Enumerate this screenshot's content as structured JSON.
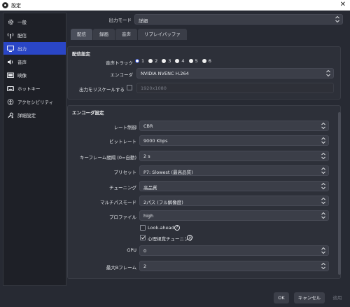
{
  "window": {
    "title": "設定"
  },
  "sidebar": {
    "items": [
      {
        "label": "一般",
        "icon": "gear-icon",
        "active": false
      },
      {
        "label": "配信",
        "icon": "broadcast-antenna-icon",
        "active": false
      },
      {
        "label": "出力",
        "icon": "monitor-output-icon",
        "active": true
      },
      {
        "label": "音声",
        "icon": "speaker-icon",
        "active": false
      },
      {
        "label": "映像",
        "icon": "screen-icon",
        "active": false
      },
      {
        "label": "ホットキー",
        "icon": "keyboard-icon",
        "active": false
      },
      {
        "label": "アクセシビリティ",
        "icon": "accessibility-icon",
        "active": false
      },
      {
        "label": "詳細設定",
        "icon": "wrench-gears-icon",
        "active": false
      }
    ]
  },
  "output_mode": {
    "label": "出力モード",
    "value": "詳細"
  },
  "tabs": [
    {
      "label": "配信",
      "active": true
    },
    {
      "label": "録画",
      "active": false
    },
    {
      "label": "音声",
      "active": false
    },
    {
      "label": "リプレイバッファ",
      "active": false
    }
  ],
  "stream_settings": {
    "title": "配信設定",
    "audio_track": {
      "label": "音声トラック",
      "options": [
        "1",
        "2",
        "3",
        "4",
        "5",
        "6"
      ],
      "selected": "1"
    },
    "encoder": {
      "label": "エンコーダ",
      "value": "NVIDIA NVENC H.264"
    },
    "rescale": {
      "label": "出力をリスケールする",
      "checked": false,
      "value": "1920x1080"
    }
  },
  "encoder_settings": {
    "title": "エンコーダ設定",
    "rate_control": {
      "label": "レート制御",
      "value": "CBR"
    },
    "bitrate": {
      "label": "ビットレート",
      "value": "9000 Kbps"
    },
    "keyframe_interval": {
      "label": "キーフレーム間隔 (0=自動)",
      "value": "2 s"
    },
    "preset": {
      "label": "プリセット",
      "value": "P7: Slowest (最高品質)"
    },
    "tuning": {
      "label": "チューニング",
      "value": "高品質"
    },
    "multipass": {
      "label": "マルチパスモード",
      "value": "2パス (フル解像度)"
    },
    "profile": {
      "label": "プロファイル",
      "value": "high"
    },
    "lookahead": {
      "label": "Look-ahead",
      "checked": false,
      "help": "?"
    },
    "psycho_visual": {
      "label": "心理視覚チューニング",
      "checked": true,
      "help": "?"
    },
    "gpu": {
      "label": "GPU",
      "value": "0"
    },
    "max_bframes": {
      "label": "最大Bフレーム",
      "value": "2"
    }
  },
  "buttons": {
    "ok": "OK",
    "cancel": "キャンセル",
    "apply": "適用"
  },
  "colors": {
    "accent": "#2a46c6",
    "background": "#272a33",
    "panel": "#2d3039"
  }
}
